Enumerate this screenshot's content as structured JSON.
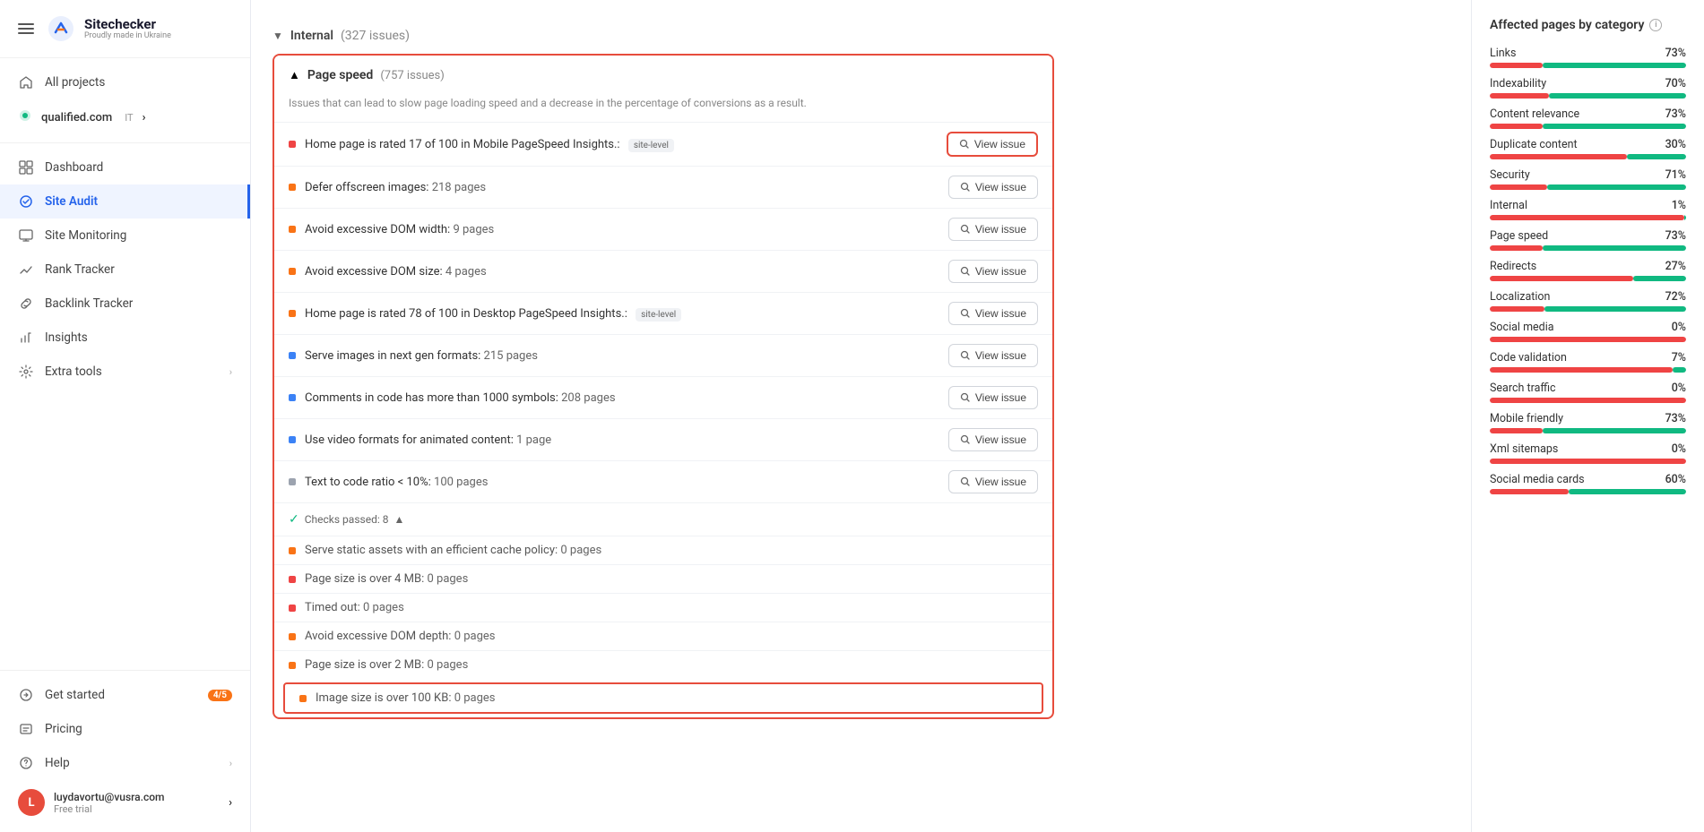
{
  "sidebar": {
    "logo": {
      "name": "Sitechecker",
      "tagline": "Proudly made in Ukraine"
    },
    "items": [
      {
        "id": "all-projects",
        "label": "All projects",
        "icon": "home"
      },
      {
        "id": "qualified",
        "label": "qualified.com",
        "badge": "IT",
        "chevron": true
      },
      {
        "id": "dashboard",
        "label": "Dashboard",
        "icon": "dashboard"
      },
      {
        "id": "site-audit",
        "label": "Site Audit",
        "icon": "site-audit",
        "active": true
      },
      {
        "id": "site-monitoring",
        "label": "Site Monitoring",
        "icon": "monitor"
      },
      {
        "id": "rank-tracker",
        "label": "Rank Tracker",
        "icon": "chart"
      },
      {
        "id": "backlink-tracker",
        "label": "Backlink Tracker",
        "icon": "link"
      },
      {
        "id": "insights",
        "label": "Insights",
        "icon": "insights"
      },
      {
        "id": "extra-tools",
        "label": "Extra tools",
        "icon": "tools",
        "chevron": true
      }
    ],
    "bottom": [
      {
        "id": "get-started",
        "label": "Get started",
        "badge": "4/5"
      },
      {
        "id": "pricing",
        "label": "Pricing"
      },
      {
        "id": "help",
        "label": "Help",
        "chevron": true
      }
    ],
    "user": {
      "email": "luydavortu@vusra.com",
      "plan": "Free trial",
      "initial": "L"
    }
  },
  "main": {
    "internal_section": {
      "label": "Internal",
      "count": "(327 issues)"
    },
    "page_speed": {
      "label": "Page speed",
      "count": "(757 issues)",
      "description": "Issues that can lead to slow page loading speed and a decrease in the percentage of conversions as a result."
    },
    "issues": [
      {
        "id": 1,
        "color": "red",
        "text": "Home page is rated 17 of 100 in Mobile PageSpeed Insights.:",
        "badge": "site-level",
        "pages": "",
        "highlighted": true
      },
      {
        "id": 2,
        "color": "orange",
        "text": "Defer offscreen images:",
        "pages": "218 pages"
      },
      {
        "id": 3,
        "color": "orange",
        "text": "Avoid excessive DOM width:",
        "pages": "9 pages"
      },
      {
        "id": 4,
        "color": "orange",
        "text": "Avoid excessive DOM size:",
        "pages": "4 pages"
      },
      {
        "id": 5,
        "color": "orange",
        "text": "Home page is rated 78 of 100 in Desktop PageSpeed Insights.:",
        "badge": "site-level",
        "pages": ""
      },
      {
        "id": 6,
        "color": "blue",
        "text": "Serve images in next gen formats:",
        "pages": "215 pages"
      },
      {
        "id": 7,
        "color": "blue",
        "text": "Comments in code has more than 1000 symbols:",
        "pages": "208 pages"
      },
      {
        "id": 8,
        "color": "blue",
        "text": "Use video formats for animated content:",
        "pages": "1 page"
      },
      {
        "id": 9,
        "color": "gray",
        "text": "Text to code ratio < 10%:",
        "pages": "100 pages"
      }
    ],
    "checks_passed": {
      "label": "Checks passed: 8"
    },
    "passed_issues": [
      {
        "id": 1,
        "color": "orange",
        "text": "Serve static assets with an efficient cache policy:",
        "pages": "0 pages"
      },
      {
        "id": 2,
        "color": "red",
        "text": "Page size is over 4 MB:",
        "pages": "0 pages"
      },
      {
        "id": 3,
        "color": "red",
        "text": "Timed out:",
        "pages": "0 pages"
      },
      {
        "id": 4,
        "color": "orange",
        "text": "Avoid excessive DOM depth:",
        "pages": "0 pages"
      },
      {
        "id": 5,
        "color": "orange",
        "text": "Page size is over 2 MB:",
        "pages": "0 pages"
      },
      {
        "id": 6,
        "color": "orange",
        "text": "Image size is over 100 KB:",
        "pages": "0 pages",
        "highlighted": true
      }
    ],
    "view_issue_label": "View issue"
  },
  "right_panel": {
    "title": "Affected pages by category",
    "categories": [
      {
        "name": "Links",
        "pct": 73,
        "label": "73%"
      },
      {
        "name": "Indexability",
        "pct": 70,
        "label": "70%"
      },
      {
        "name": "Content relevance",
        "pct": 73,
        "label": "73%"
      },
      {
        "name": "Duplicate content",
        "pct": 30,
        "label": "30%"
      },
      {
        "name": "Security",
        "pct": 71,
        "label": "71%"
      },
      {
        "name": "Internal",
        "pct": 1,
        "label": "1%"
      },
      {
        "name": "Page speed",
        "pct": 73,
        "label": "73%"
      },
      {
        "name": "Redirects",
        "pct": 27,
        "label": "27%"
      },
      {
        "name": "Localization",
        "pct": 72,
        "label": "72%"
      },
      {
        "name": "Social media",
        "pct": 0,
        "label": "0%"
      },
      {
        "name": "Code validation",
        "pct": 7,
        "label": "7%"
      },
      {
        "name": "Search traffic",
        "pct": 0,
        "label": "0%"
      },
      {
        "name": "Mobile friendly",
        "pct": 73,
        "label": "73%"
      },
      {
        "name": "Xml sitemaps",
        "pct": 0,
        "label": "0%"
      },
      {
        "name": "Social media cards",
        "pct": 60,
        "label": "60%"
      }
    ]
  }
}
